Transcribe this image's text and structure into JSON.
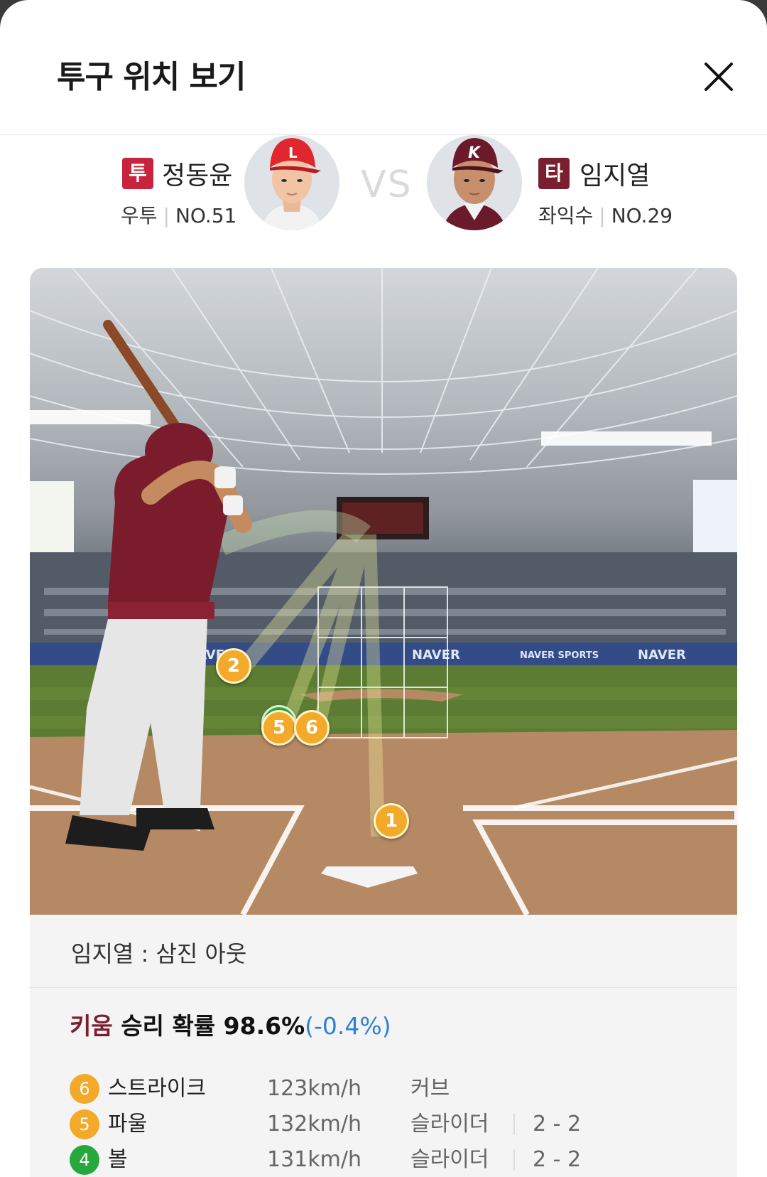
{
  "header": {
    "title": "투구 위치 보기"
  },
  "matchup": {
    "pitcher": {
      "role": "투",
      "role_color": "#c8243d",
      "name": "정동윤",
      "hand": "우투",
      "number": "NO.51",
      "team_color": "#e0262e"
    },
    "vs": "VS",
    "batter": {
      "role": "타",
      "role_color": "#7a1f30",
      "name": "임지열",
      "hand": "좌익수",
      "number": "NO.29",
      "team_color": "#6b1a2b"
    }
  },
  "field": {
    "banners": [
      "NAVER",
      "NAVER",
      "NAVER SPORTS",
      "NAVER"
    ],
    "markers": [
      {
        "num": "2",
        "color": "orange"
      },
      {
        "num": "5",
        "color": "orange"
      },
      {
        "num": "6",
        "color": "orange"
      },
      {
        "num": "1",
        "color": "orange"
      }
    ]
  },
  "result": {
    "outcome": "임지열 : 삼진 아웃",
    "win_prob": {
      "team": "키움",
      "label": "승리 확률 98.6%",
      "delta": "(-0.4%)"
    },
    "pitches": [
      {
        "num": "6",
        "color": "#f3a92a",
        "result": "스트라이크",
        "speed": "123km/h",
        "type": "커브",
        "count": ""
      },
      {
        "num": "5",
        "color": "#f3a92a",
        "result": "파울",
        "speed": "132km/h",
        "type": "슬라이더",
        "count": "2 - 2"
      },
      {
        "num": "4",
        "color": "#27a83d",
        "result": "볼",
        "speed": "131km/h",
        "type": "슬라이더",
        "count": "2 - 2"
      }
    ]
  }
}
